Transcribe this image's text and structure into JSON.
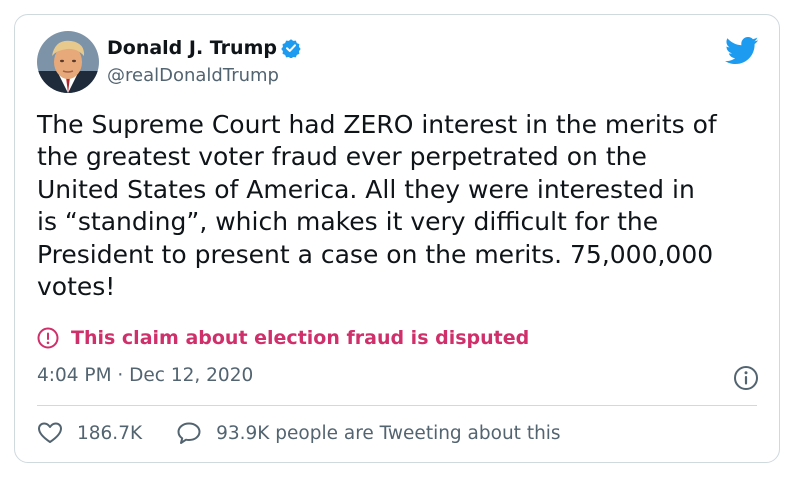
{
  "tweet": {
    "author": {
      "display_name": "Donald J. Trump",
      "handle": "@realDonaldTrump",
      "verified": true
    },
    "text_lines": [
      "The Supreme Court had ZERO interest in the merits of",
      "the greatest voter fraud ever perpetrated on the",
      "United States of America. All they were interested in",
      "is “standing”, which makes it very difficult for the",
      "President to present a case on the merits. 75,000,000",
      "votes!"
    ],
    "notice": "This claim about election fraud is disputed",
    "timestamp": "4:04 PM · Dec 12, 2020",
    "likes": "186.7K",
    "conversation": "93.9K people are Tweeting about this"
  },
  "colors": {
    "verified_blue": "#1d9bf0",
    "notice_red": "#d0306a",
    "muted_gray": "#536471",
    "border": "#cfd9de"
  },
  "icons": {
    "verified": "verified-badge-icon",
    "brand": "twitter-bird-icon",
    "notice": "exclamation-circle-icon",
    "info": "info-icon",
    "like": "heart-icon",
    "reply": "speech-bubble-icon"
  }
}
